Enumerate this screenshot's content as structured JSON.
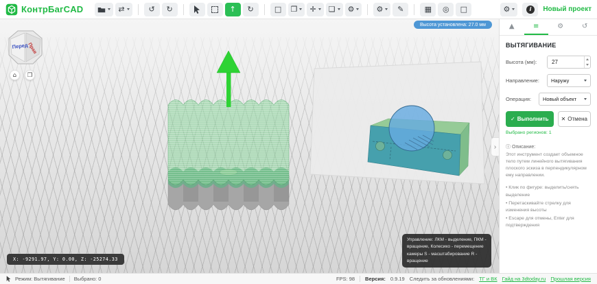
{
  "toolbar": {
    "app_title": "КонтрБагCAD",
    "new_project": "Новый проект",
    "glyphs": {
      "swap": "⇄",
      "undo": "↺",
      "redo": "↻",
      "extrude": "↑",
      "orbit": "↻",
      "rect": "□",
      "copy": "❐",
      "move": "✛",
      "group": "❏",
      "operations": "⚙",
      "tool_settings": "⚙",
      "pencil": "✎",
      "grid": "▦",
      "snap": "◎",
      "frame": "□",
      "app_settings": "⚙",
      "info": "i"
    }
  },
  "viewport": {
    "height_badge": "Высота установлена: 27.0 мм",
    "coordinates": "X: -9291.97, Y: 0.00, Z: -25274.33",
    "tooltip": "Управление: ЛКМ - выделение, ПКМ - вращение, Колесико - перемещение камеры S - масштабирование R - вращение",
    "nav_cube": {
      "front_label": "Перед",
      "right_label": "Прав"
    },
    "nav_buttons": {
      "home": "⌂",
      "projection": "❒"
    },
    "collapse_glyph": "›"
  },
  "panel": {
    "tabs": {
      "shapes": "▲",
      "properties": "≡",
      "settings": "⚙",
      "history": "↺"
    },
    "title": "ВЫТЯГИВАНИЕ",
    "height_field": {
      "label": "Высота (мм):",
      "value": "27"
    },
    "direction_field": {
      "label": "Направление:",
      "value": "Наружу"
    },
    "operation_field": {
      "label": "Операция:",
      "value": "Новый объект"
    },
    "execute_icon": "✓",
    "execute_label": "Выполнить",
    "cancel_icon": "✕",
    "cancel_label": "Отмена",
    "selected_regions": "Выбрано регионов: 1",
    "description_icon": "ⓘ",
    "description_label": "Описание:",
    "description_text": "Этот инструмент создает объемное тело путем линейного вытягивания плоского эскиза в перпендикулярном ему направлении.",
    "hints": [
      "Клик по фигуре: выделить/снять выделение",
      "Перетаскивайте стрелку для изменения высоты",
      "Escape для отмены, Enter для подтверждения"
    ]
  },
  "statusbar": {
    "mode": "Режим: Вытягивание",
    "selected": "Выбрано: 0",
    "fps": "FPS: 98",
    "version_label": "Версия:",
    "version_value": "0.9.19",
    "updates_label": "Следить за обновлениями:",
    "link_social": "ТГ и ВК",
    "link_guide": "Гайд на 3dtoday.ru",
    "link_previous": "Прошлая версия"
  },
  "colors": {
    "accent_green": "#21ba45",
    "badge_blue": "#4e97d5",
    "extrude_green": "#2ed334",
    "object_teal": "#46a0ad"
  }
}
